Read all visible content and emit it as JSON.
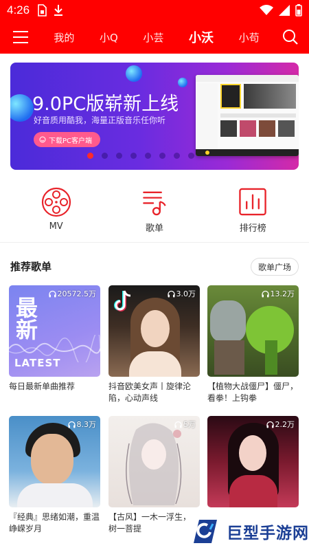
{
  "status_bar": {
    "time": "4:26"
  },
  "nav": {
    "tabs": [
      {
        "label": "我的",
        "active": false
      },
      {
        "label": "小Q",
        "active": false
      },
      {
        "label": "小芸",
        "active": false
      },
      {
        "label": "小沃",
        "active": true
      },
      {
        "label": "小苟",
        "active": false
      }
    ]
  },
  "banner": {
    "title": "9.0PC版崭新上线",
    "subtitle": "好音质用酷我，海量正版音乐任你听",
    "button_label": "下载PC客户端",
    "dot_count": 8,
    "active_dot": 0
  },
  "shortcuts": [
    {
      "label": "MV",
      "icon": "film-reel-icon"
    },
    {
      "label": "歌单",
      "icon": "music-list-icon"
    },
    {
      "label": "排行榜",
      "icon": "chart-bars-icon"
    }
  ],
  "section": {
    "title": "推荐歌单",
    "more_label": "歌单广场"
  },
  "playlists": [
    {
      "count": "20572.5万",
      "title": "每日最新单曲推荐",
      "cover_text_1": "最",
      "cover_text_2": "新",
      "cover_text_3": "LATEST"
    },
    {
      "count": "3.0万",
      "title": "抖音欧美女声丨旋律沦陷，心动声线"
    },
    {
      "count": "13.2万",
      "title": "【植物大战僵尸】僵尸，看拳！上钩拳"
    },
    {
      "count": "8.3万",
      "title": "『经典』思绪如潮，重温峥嵘岁月"
    },
    {
      "count": "5万",
      "title": "【古风】一木一浮生，一树一菩提"
    },
    {
      "count": "2.2万",
      "title": ""
    }
  ],
  "watermark": {
    "text": "巨型手游网"
  },
  "colors": {
    "brand_red": "#ff0000",
    "accent_icon": "#e8232a"
  }
}
